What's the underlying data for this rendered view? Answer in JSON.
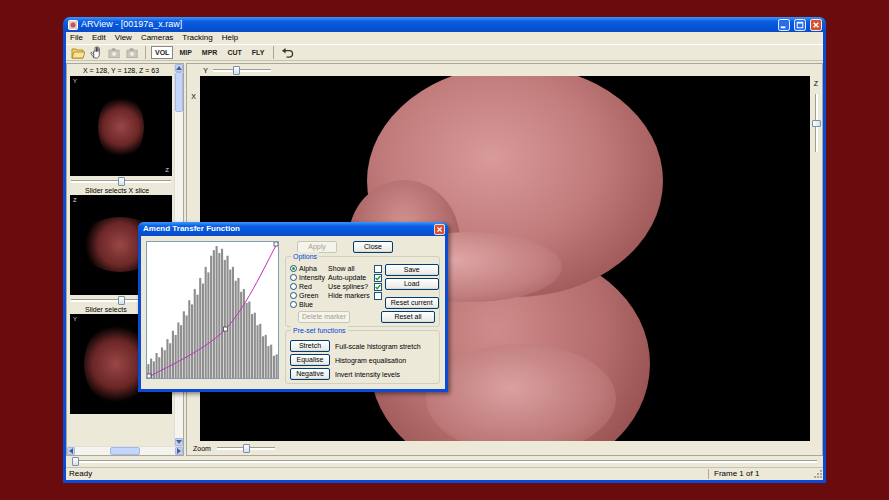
{
  "window": {
    "title": "ARView - [00197a_x.raw]"
  },
  "menu": [
    "File",
    "Edit",
    "View",
    "Cameras",
    "Tracking",
    "Help"
  ],
  "toolbar": {
    "file_buttons": [
      {
        "disabled": false
      },
      {
        "disabled": false
      },
      {
        "disabled": true
      },
      {
        "disabled": true
      }
    ],
    "modes": [
      {
        "label": "VOL",
        "selected": true
      },
      {
        "label": "MIP",
        "selected": false
      },
      {
        "label": "MPR",
        "selected": false
      },
      {
        "label": "CUT",
        "selected": false
      },
      {
        "label": "FLY",
        "selected": false
      }
    ],
    "undo": {
      "disabled": false
    }
  },
  "slices": {
    "coords": "X = 128, Y = 128, Z = 63",
    "views": [
      {
        "corner_top": "Y",
        "corner_bottom": "Z",
        "slider_level": 0.5,
        "caption": "Slider selects X slice"
      },
      {
        "corner_top": "Z",
        "corner_bottom": "X",
        "slider_level": 0.5,
        "caption": "Slider selects"
      },
      {
        "corner_top": "Y"
      }
    ],
    "vscroll_level": 0,
    "hscroll_level": 0.5
  },
  "view": {
    "axis_top": "Y",
    "axis_left": "X",
    "axis_right": "Z",
    "top_slider_level": 0.4,
    "right_slider_level": 0.5,
    "zoom_label": "Zoom",
    "zoom_level": 0.5
  },
  "timeline": {
    "level": 0
  },
  "status_bar": {
    "left": "Ready",
    "right": "Frame 1 of 1"
  },
  "dialog": {
    "title": "Amend Transfer Function",
    "buttons": [
      {
        "label": "Apply",
        "disabled": true
      },
      {
        "label": "Close",
        "disabled": false
      }
    ],
    "options_title": "Options",
    "channels": [
      {
        "label": "Alpha",
        "selected": true
      },
      {
        "label": "Intensity",
        "selected": false
      },
      {
        "label": "Red",
        "selected": false
      },
      {
        "label": "Green",
        "selected": false
      },
      {
        "label": "Blue",
        "selected": false
      }
    ],
    "checks": [
      {
        "label": "Show all",
        "checked": false
      },
      {
        "label": "Auto-update",
        "checked": true
      },
      {
        "label": "Use splines?",
        "checked": true
      },
      {
        "label": "Hide markers",
        "checked": false
      }
    ],
    "file_buttons": [
      "Save",
      "Load"
    ],
    "delete_marker": {
      "label": "Delete marker",
      "disabled": true
    },
    "reset_buttons": [
      "Reset current",
      "Reset all"
    ],
    "presets_title": "Pre-set functions",
    "presets": [
      {
        "label": "Stretch",
        "description": "Full-scale histogram stretch"
      },
      {
        "label": "Equalise",
        "description": "Histogram equalisation"
      },
      {
        "label": "Negative",
        "description": "Invert intensity levels"
      }
    ],
    "histogram": {
      "bins": [
        10,
        14,
        12,
        18,
        15,
        22,
        20,
        28,
        25,
        34,
        31,
        40,
        38,
        48,
        45,
        56,
        53,
        64,
        60,
        72,
        68,
        80,
        76,
        88,
        92,
        95,
        90,
        93,
        85,
        88,
        78,
        80,
        70,
        72,
        62,
        64,
        54,
        55,
        46,
        47,
        38,
        39,
        30,
        31,
        23,
        24,
        16,
        17
      ]
    },
    "transfer": {
      "points": [
        {
          "x": 0,
          "y": 0
        },
        {
          "x": 0.6,
          "y": 0.36
        },
        {
          "x": 1,
          "y": 1
        }
      ]
    }
  }
}
